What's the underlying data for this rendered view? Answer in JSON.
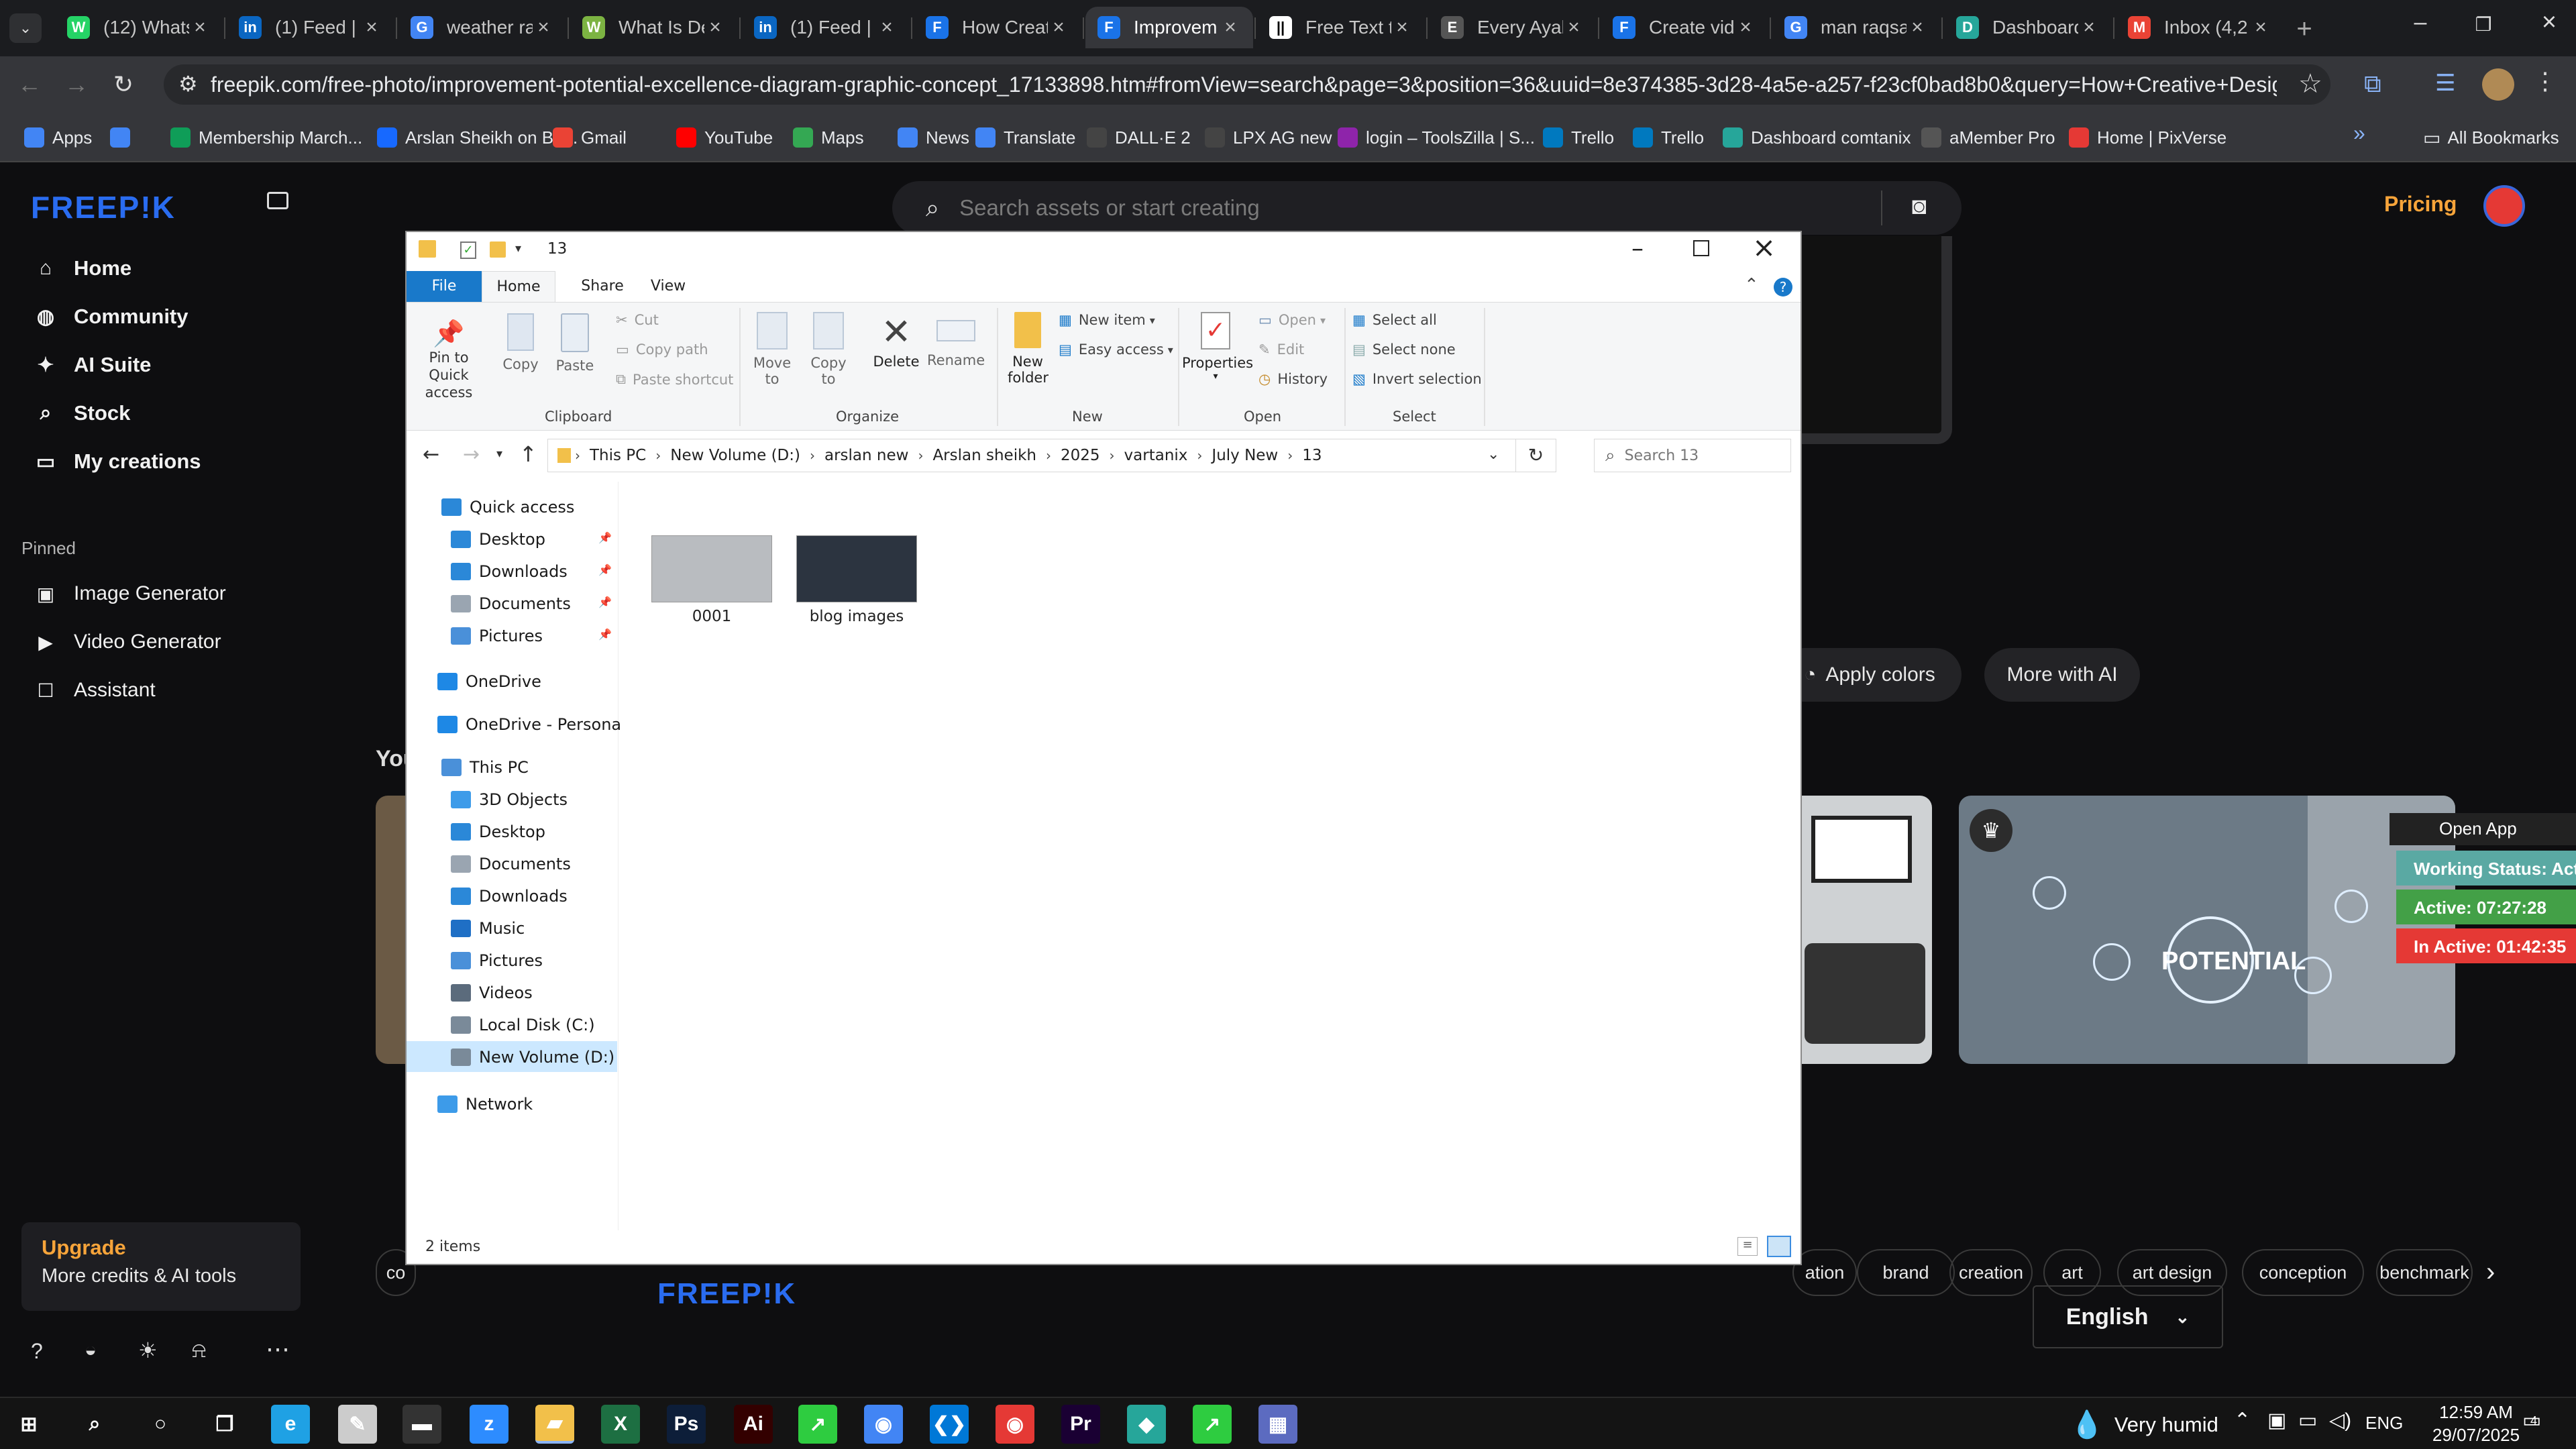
{
  "browser": {
    "tabs": [
      {
        "title": "(12) Whats",
        "icon": "whatsapp-icon",
        "color": "#25d366",
        "glyph": "W"
      },
      {
        "title": "(1) Feed | L",
        "icon": "linkedin-icon",
        "color": "#0a66c2",
        "glyph": "in"
      },
      {
        "title": "weather ra",
        "icon": "google-icon",
        "color": "#4285f4",
        "glyph": "G"
      },
      {
        "title": "What Is De",
        "icon": "site-icon",
        "color": "#7cb342",
        "glyph": "W"
      },
      {
        "title": "(1) Feed | L",
        "icon": "linkedin-icon",
        "color": "#0a66c2",
        "glyph": "in"
      },
      {
        "title": "How Creat",
        "icon": "docs-icon",
        "color": "#1a73e8",
        "glyph": "F"
      },
      {
        "title": "Improvem",
        "icon": "freepik-icon",
        "color": "#1a73e8",
        "glyph": "F"
      },
      {
        "title": "Free Text t",
        "icon": "site-icon",
        "color": "#ffffff",
        "glyph": "||"
      },
      {
        "title": "Every Ayah",
        "icon": "site-icon",
        "color": "#555555",
        "glyph": "E"
      },
      {
        "title": "Create vid",
        "icon": "docs-icon",
        "color": "#1a73e8",
        "glyph": "F"
      },
      {
        "title": "man raqsa",
        "icon": "google-icon",
        "color": "#4285f4",
        "glyph": "G"
      },
      {
        "title": "Dashboard",
        "icon": "dashboard-icon",
        "color": "#26a69a",
        "glyph": "D"
      },
      {
        "title": "Inbox (4,2",
        "icon": "gmail-icon",
        "color": "#ea4335",
        "glyph": "M"
      }
    ],
    "active_tab": 6,
    "url": "freepik.com/free-photo/improvement-potential-excellence-diagram-graphic-concept_17133898.htm#fromView=search&page=3&position=36&uuid=8e374385-3d28-4a5e-a257-f23cf0bad8b0&query=How+Creative+Design+Boosts+Conversion+R...",
    "bookmarks": [
      {
        "label": "Apps",
        "color": "#4285f4"
      },
      {
        "label": "",
        "color": "#4285f4"
      },
      {
        "label": "Membership March...",
        "color": "#0f9d58"
      },
      {
        "label": "Arslan Sheikh on Be...",
        "color": "#1769ff"
      },
      {
        "label": "Gmail",
        "color": "#ea4335"
      },
      {
        "label": "YouTube",
        "color": "#ff0000"
      },
      {
        "label": "Maps",
        "color": "#34a853"
      },
      {
        "label": "News",
        "color": "#4285f4"
      },
      {
        "label": "Translate",
        "color": "#4285f4"
      },
      {
        "label": "DALL·E 2",
        "color": "#444444"
      },
      {
        "label": "LPX AG new",
        "color": "#444444"
      },
      {
        "label": "login – ToolsZilla | S...",
        "color": "#8e24aa"
      },
      {
        "label": "Trello",
        "color": "#0079bf"
      },
      {
        "label": "Trello",
        "color": "#0079bf"
      },
      {
        "label": "Dashboard comtanix",
        "color": "#26a69a"
      },
      {
        "label": "aMember Pro",
        "color": "#555555"
      },
      {
        "label": "Home | PixVerse",
        "color": "#e53935"
      }
    ],
    "all_bookmarks": "All Bookmarks"
  },
  "freepik": {
    "logo": "FREEP!K",
    "search_placeholder": "Search assets or start creating",
    "pricing": "Pricing",
    "nav": [
      {
        "label": "Home",
        "icon": "home-icon",
        "glyph": "⌂"
      },
      {
        "label": "Community",
        "icon": "globe-icon",
        "glyph": "◍"
      },
      {
        "label": "AI Suite",
        "icon": "sparkle-icon",
        "glyph": "✦"
      },
      {
        "label": "Stock",
        "icon": "search-icon",
        "glyph": "⌕"
      },
      {
        "label": "My creations",
        "icon": "folder-icon",
        "glyph": "▭"
      }
    ],
    "pinned_title": "Pinned",
    "pinned": [
      {
        "label": "Image Generator",
        "icon": "image-icon",
        "glyph": "▣"
      },
      {
        "label": "Video Generator",
        "icon": "video-icon",
        "glyph": "▶"
      },
      {
        "label": "Assistant",
        "icon": "assistant-icon",
        "glyph": "☐"
      }
    ],
    "upgrade_title": "Upgrade",
    "upgrade_sub": "More credits & AI tools",
    "apply_colors": "Apply colors",
    "more_with_ai": "More with AI",
    "section_title": "You",
    "tags": [
      "co",
      "ation",
      "brand",
      "creation",
      "art",
      "art design",
      "conception",
      "benchmark"
    ],
    "language": "English",
    "footer_logo": "FREEP!K",
    "potential_label": "POTENTIAL",
    "tracker": {
      "open_app": "Open App",
      "status": "Working Status: Active",
      "active": "Active: 07:27:28",
      "inactive": "In Active: 01:42:35"
    }
  },
  "explorer": {
    "title": "13",
    "tabs": [
      "File",
      "Home",
      "Share",
      "View"
    ],
    "clipboard": {
      "pin": "Pin to Quick access",
      "copy": "Copy",
      "paste": "Paste",
      "cut": "Cut",
      "copy_path": "Copy path",
      "paste_shortcut": "Paste shortcut",
      "label": "Clipboard"
    },
    "organize": {
      "move_to": "Move to",
      "copy_to": "Copy to",
      "delete": "Delete",
      "rename": "Rename",
      "label": "Organize"
    },
    "new_group": {
      "new_folder": "New folder",
      "new_item": "New item",
      "easy_access": "Easy access",
      "label": "New"
    },
    "open_group": {
      "properties": "Properties",
      "open": "Open",
      "edit": "Edit",
      "history": "History",
      "label": "Open"
    },
    "select_group": {
      "select_all": "Select all",
      "select_none": "Select none",
      "invert": "Invert selection",
      "label": "Select"
    },
    "breadcrumb": [
      "This PC",
      "New Volume (D:)",
      "arslan new",
      "Arslan sheikh",
      "2025",
      "vartanix",
      "July New",
      "13"
    ],
    "search_placeholder": "Search 13",
    "quick_access": "Quick access",
    "quick_items": [
      {
        "label": "Desktop",
        "color": "#2b88d8"
      },
      {
        "label": "Downloads",
        "color": "#2b88d8"
      },
      {
        "label": "Documents",
        "color": "#9aa5b1"
      },
      {
        "label": "Pictures",
        "color": "#4a90d9"
      }
    ],
    "onedrive": "OneDrive",
    "onedrive_personal": "OneDrive - Personal",
    "this_pc": "This PC",
    "pc_items": [
      {
        "label": "3D Objects",
        "color": "#3d9be9"
      },
      {
        "label": "Desktop",
        "color": "#2b88d8"
      },
      {
        "label": "Documents",
        "color": "#9aa5b1"
      },
      {
        "label": "Downloads",
        "color": "#2b88d8"
      },
      {
        "label": "Music",
        "color": "#1f6fc5"
      },
      {
        "label": "Pictures",
        "color": "#4a90d9"
      },
      {
        "label": "Videos",
        "color": "#5b6b7c"
      },
      {
        "label": "Local Disk (C:)",
        "color": "#7a8a99"
      },
      {
        "label": "New Volume (D:)",
        "color": "#7a8a99"
      }
    ],
    "network": "Network",
    "files": [
      {
        "name": "0001",
        "thumb": "#b9bcc0"
      },
      {
        "name": "blog images",
        "thumb": "#2c3440"
      }
    ],
    "status": "2 items"
  },
  "taskbar": {
    "weather": "Very humid",
    "lang": "ENG",
    "time": "12:59 AM",
    "date": "29/07/2025",
    "notifications": "4",
    "apps": [
      {
        "icon": "windows-start-icon",
        "color": "#ffffff",
        "glyph": "⊞"
      },
      {
        "icon": "search-icon",
        "color": "#ffffff",
        "glyph": "⌕"
      },
      {
        "icon": "cortana-icon",
        "color": "#ffffff",
        "glyph": "○"
      },
      {
        "icon": "task-view-icon",
        "color": "#ffffff",
        "glyph": "❐"
      },
      {
        "icon": "edge-icon",
        "color": "#1fa1e4",
        "glyph": "e"
      },
      {
        "icon": "pen-icon",
        "color": "#cccccc",
        "glyph": "✎"
      },
      {
        "icon": "terminal-icon",
        "color": "#333333",
        "glyph": "▬"
      },
      {
        "icon": "zoom-icon",
        "color": "#2d8cff",
        "glyph": "z"
      },
      {
        "icon": "file-explorer-icon",
        "color": "#f2c04a",
        "glyph": "▰"
      },
      {
        "icon": "excel-icon",
        "color": "#1d6f42",
        "glyph": "X"
      },
      {
        "icon": "photoshop-icon",
        "color": "#0d1e39",
        "glyph": "Ps"
      },
      {
        "icon": "illustrator-icon",
        "color": "#330000",
        "glyph": "Ai"
      },
      {
        "icon": "app-green-icon",
        "color": "#2ecc40",
        "glyph": "↗"
      },
      {
        "icon": "chrome-icon",
        "color": "#4285f4",
        "glyph": "◉"
      },
      {
        "icon": "vscode-icon",
        "color": "#0078d7",
        "glyph": "❮❯"
      },
      {
        "icon": "chrome-profile-icon",
        "color": "#e53935",
        "glyph": "◉"
      },
      {
        "icon": "premiere-icon",
        "color": "#1a0033",
        "glyph": "Pr"
      },
      {
        "icon": "app-teal-icon",
        "color": "#26a69a",
        "glyph": "◆"
      },
      {
        "icon": "app-green2-icon",
        "color": "#2ecc40",
        "glyph": "↗"
      },
      {
        "icon": "calculator-icon",
        "color": "#5c6bc0",
        "glyph": "▦"
      }
    ]
  }
}
